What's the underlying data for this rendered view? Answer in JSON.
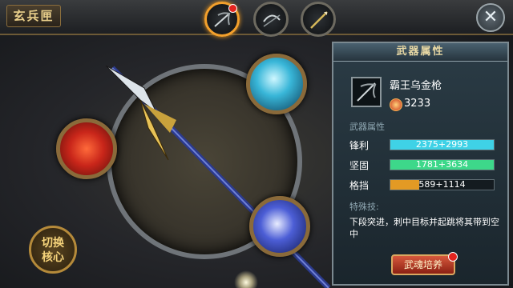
{
  "header": {
    "title": "玄兵匣",
    "weapon_tabs": [
      {
        "name": "weapon-1",
        "active": true,
        "has_alert": true
      },
      {
        "name": "weapon-2",
        "active": false,
        "has_alert": false
      },
      {
        "name": "weapon-3",
        "active": false,
        "has_alert": false
      }
    ],
    "close_icon": "close-icon"
  },
  "scene": {
    "switch_core": {
      "line1": "切换",
      "line2": "核心"
    },
    "orbs": [
      "red-rune-orb",
      "cyan-orb",
      "blue-orb"
    ]
  },
  "panel": {
    "title": "武器属性",
    "weapon_name": "霸王乌金枪",
    "power_value": "3233",
    "attributes_title": "武器属性",
    "attributes": [
      {
        "label": "锋利",
        "text": "2375+2993",
        "fill": 1.0,
        "color": "#3fd2e6"
      },
      {
        "label": "坚固",
        "text": "1781+3634",
        "fill": 1.0,
        "color": "#3dd88a"
      },
      {
        "label": "格挡",
        "text": "589+1114",
        "fill": 0.28,
        "color": "#e39a24"
      }
    ],
    "skill_title": "特殊技:",
    "skill_desc": "下段突进，刺中目标并起跳将其带到空中",
    "cultivate_button": "武魂培养"
  }
}
